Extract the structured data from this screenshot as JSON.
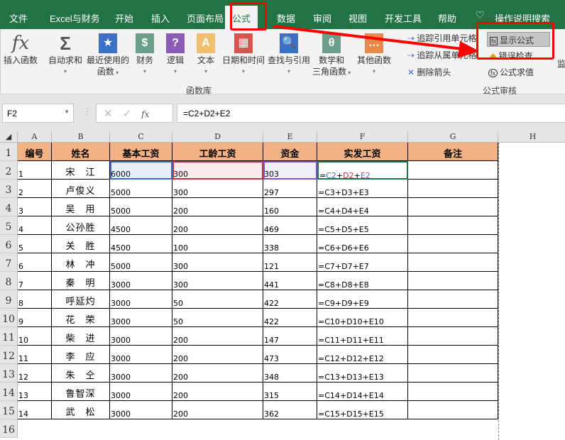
{
  "tabs": [
    "文件",
    "Excel与财务",
    "开始",
    "插入",
    "页面布局",
    "公式",
    "数据",
    "审阅",
    "视图",
    "开发工具",
    "帮助",
    "操作说明搜索"
  ],
  "ribbon": {
    "buttons": [
      {
        "label": "插入函数",
        "icon": "fx"
      },
      {
        "label": "自动求和",
        "icon": "Σ"
      },
      {
        "label": "最近使用的",
        "label2": "函数",
        "icon": "★"
      },
      {
        "label": "财务",
        "icon": "$"
      },
      {
        "label": "逻辑",
        "icon": "?"
      },
      {
        "label": "文本",
        "icon": "A"
      },
      {
        "label": "日期和时间",
        "icon": "▦"
      },
      {
        "label": "查找与引用",
        "icon": "🔍"
      },
      {
        "label": "数学和",
        "label2": "三角函数",
        "icon": "θ"
      },
      {
        "label": "其他函数",
        "icon": "…"
      }
    ],
    "group1": "函数库",
    "audit": {
      "trace_precedents": "追踪引用单元格",
      "trace_dependents": "追踪从属单元格",
      "remove_arrows": "删除箭头",
      "show_formulas": "显示公式",
      "error_check": "错误检查",
      "evaluate": "公式求值",
      "group": "公式审核",
      "watch": "监"
    }
  },
  "formula_bar": {
    "name_box": "F2",
    "formula": "=C2+D2+E2"
  },
  "columns": [
    "A",
    "B",
    "C",
    "D",
    "E",
    "F",
    "G",
    "H"
  ],
  "headers": [
    "编号",
    "姓名",
    "基本工资",
    "工龄工资",
    "资金",
    "实发工资",
    "备注"
  ],
  "rows": [
    [
      "1",
      "宋　江",
      "6000",
      "300",
      "303",
      "=C2+D2+E2"
    ],
    [
      "2",
      "卢俊义",
      "5000",
      "300",
      "297",
      "=C3+D3+E3"
    ],
    [
      "3",
      "吴　用",
      "5000",
      "200",
      "160",
      "=C4+D4+E4"
    ],
    [
      "4",
      "公孙胜",
      "4500",
      "200",
      "469",
      "=C5+D5+E5"
    ],
    [
      "5",
      "关　胜",
      "4500",
      "100",
      "338",
      "=C6+D6+E6"
    ],
    [
      "6",
      "林　冲",
      "5000",
      "300",
      "121",
      "=C7+D7+E7"
    ],
    [
      "7",
      "秦　明",
      "3000",
      "300",
      "441",
      "=C8+D8+E8"
    ],
    [
      "8",
      "呼延灼",
      "3000",
      "50",
      "422",
      "=C9+D9+E9"
    ],
    [
      "9",
      "花　荣",
      "3000",
      "50",
      "422",
      "=C10+D10+E10"
    ],
    [
      "10",
      "柴　进",
      "3000",
      "200",
      "147",
      "=C11+D11+E11"
    ],
    [
      "11",
      "李　应",
      "3000",
      "200",
      "473",
      "=C12+D12+E12"
    ],
    [
      "12",
      "朱　仝",
      "3000",
      "200",
      "348",
      "=C13+D13+E13"
    ],
    [
      "13",
      "鲁智深",
      "3000",
      "200",
      "315",
      "=C14+D14+E14"
    ],
    [
      "14",
      "武　松",
      "3000",
      "200",
      "362",
      "=C15+D15+E15"
    ]
  ],
  "row_numbers": [
    "1",
    "2",
    "3",
    "4",
    "5",
    "6",
    "7",
    "8",
    "9",
    "10",
    "11",
    "12",
    "13",
    "14",
    "15",
    "16"
  ],
  "colors": {
    "green": "#217346",
    "header_fill": "#f4b183",
    "ref_c": "#3a6fc4",
    "ref_d": "#c0343c",
    "ref_e": "#7e57c2"
  }
}
